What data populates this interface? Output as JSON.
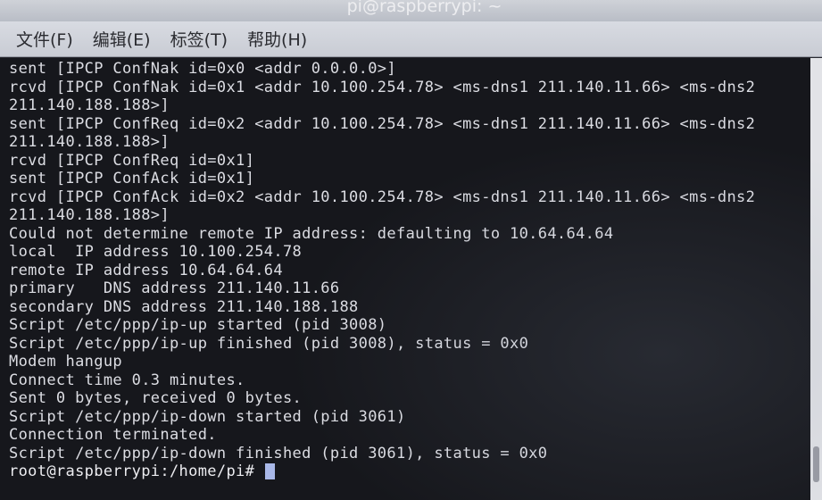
{
  "window": {
    "title": "pi@raspberrypi: ~"
  },
  "menu": {
    "items": [
      "文件(F)",
      "编辑(E)",
      "标签(T)",
      "帮助(H)"
    ]
  },
  "terminal": {
    "lines": [
      "sent [IPCP ConfNak id=0x0 <addr 0.0.0.0>]",
      "rcvd [IPCP ConfNak id=0x1 <addr 10.100.254.78> <ms-dns1 211.140.11.66> <ms-dns2",
      "211.140.188.188>]",
      "sent [IPCP ConfReq id=0x2 <addr 10.100.254.78> <ms-dns1 211.140.11.66> <ms-dns2",
      "211.140.188.188>]",
      "rcvd [IPCP ConfReq id=0x1]",
      "sent [IPCP ConfAck id=0x1]",
      "rcvd [IPCP ConfAck id=0x2 <addr 10.100.254.78> <ms-dns1 211.140.11.66> <ms-dns2",
      "211.140.188.188>]",
      "Could not determine remote IP address: defaulting to 10.64.64.64",
      "local  IP address 10.100.254.78",
      "remote IP address 10.64.64.64",
      "primary   DNS address 211.140.11.66",
      "secondary DNS address 211.140.188.188",
      "Script /etc/ppp/ip-up started (pid 3008)",
      "Script /etc/ppp/ip-up finished (pid 3008), status = 0x0",
      "Modem hangup",
      "Connect time 0.3 minutes.",
      "Sent 0 bytes, received 0 bytes.",
      "Script /etc/ppp/ip-down started (pid 3061)",
      "Connection terminated.",
      "Script /etc/ppp/ip-down finished (pid 3061), status = 0x0"
    ],
    "prompt": "root@raspberrypi:/home/pi# "
  }
}
